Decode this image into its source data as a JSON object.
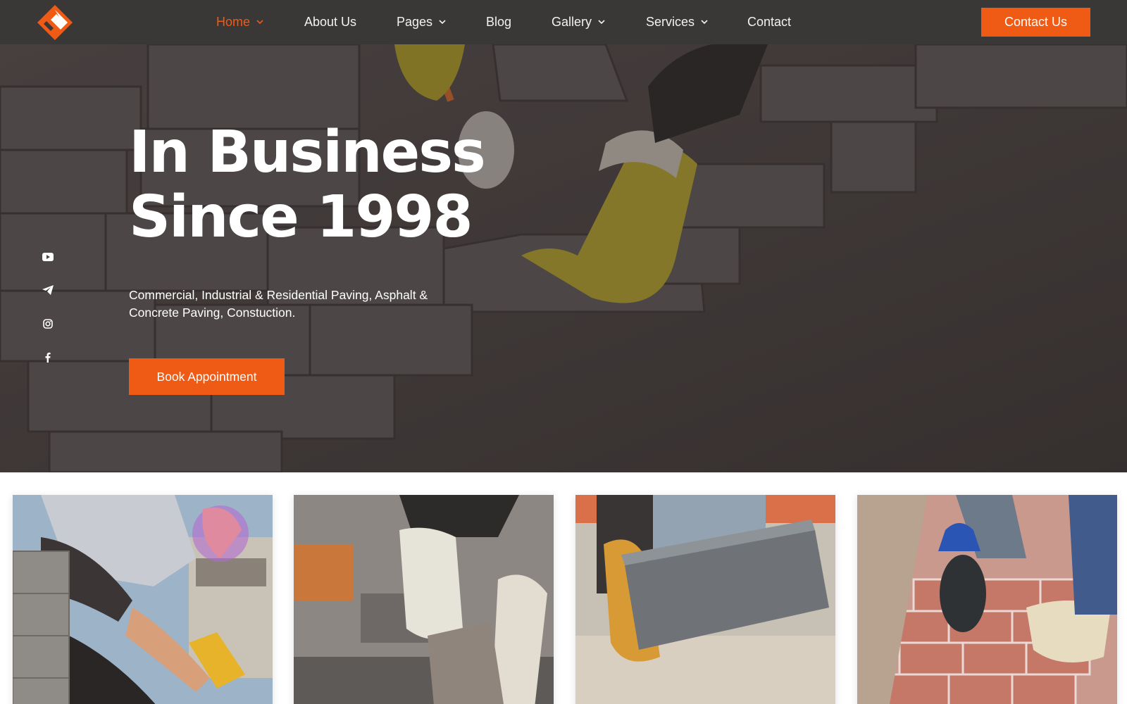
{
  "brand": {
    "logo_icon": "orange-diamond-logo-icon",
    "accent_color": "#ef5a14",
    "header_bg": "#3a3737"
  },
  "nav": {
    "items": [
      {
        "label": "Home",
        "has_dropdown": true,
        "active": true
      },
      {
        "label": "About Us",
        "has_dropdown": false,
        "active": false
      },
      {
        "label": "Pages",
        "has_dropdown": true,
        "active": false
      },
      {
        "label": "Blog",
        "has_dropdown": false,
        "active": false
      },
      {
        "label": "Gallery",
        "has_dropdown": true,
        "active": false
      },
      {
        "label": "Services",
        "has_dropdown": true,
        "active": false
      },
      {
        "label": "Contact",
        "has_dropdown": false,
        "active": false
      }
    ],
    "cta_label": "Contact Us"
  },
  "hero": {
    "title_line1": "In Business",
    "title_line2": "Since 1998",
    "subtitle_line1": "Commercial, Industrial & Residential Paving, Asphalt &",
    "subtitle_line2": "Concrete Paving, Constuction.",
    "button_label": "Book Appointment",
    "social_icons": [
      "youtube-icon",
      "telegram-icon",
      "instagram-icon",
      "facebook-icon"
    ]
  },
  "gallery": {
    "cards": [
      {
        "icon": "worker-laying-bricks-photo"
      },
      {
        "icon": "gloved-hands-placing-paver-photo"
      },
      {
        "icon": "hands-holding-stone-block-photo"
      },
      {
        "icon": "mallet-tapping-red-pavers-photo"
      }
    ]
  }
}
